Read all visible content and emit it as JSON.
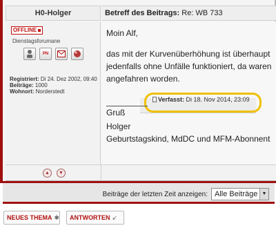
{
  "post": {
    "author_header": "H0-Holger",
    "subject_label": "Betreff des Beitrags:",
    "subject_value": "Re: WB 733",
    "author": {
      "status": "OFFLINE",
      "rank": "Dienstagsforumane",
      "registered_label": "Registriert:",
      "registered_value": "Di 24. Dez 2002, 09:40",
      "posts_label": "Beiträge:",
      "posts_value": "1000",
      "residence_label": "Wohnort:",
      "residence_value": "Norderstedt",
      "icons": [
        "profile-icon",
        "pm-icon",
        "email-icon",
        "www-icon"
      ],
      "pm_text": "PN"
    },
    "message": {
      "greeting": "Moin Alf,",
      "body": [
        "das mit der Kurvenüberhöhung ist überhaupt",
        "jedenfalls ohne Unfälle funktioniert, da waren",
        "angefahren worden."
      ],
      "posted_label": "Verfasst:",
      "posted_value": "Di 18. Nov 2014, 23:09",
      "signature": [
        "Gruß",
        "Holger",
        "Geburtstagskind, MdDC und MFM-Abonnent"
      ]
    },
    "nav": [
      "up-arrow-icon",
      "down-arrow-icon"
    ]
  },
  "filter": {
    "label": "Beiträge der letzten Zeit anzeigen:",
    "selected": "Alle Beiträge"
  },
  "actions": {
    "new_topic": "NEUES THEMA",
    "reply": "ANTWORTEN"
  },
  "colors": {
    "accent": "#a01010",
    "highlight": "#f0c000"
  }
}
